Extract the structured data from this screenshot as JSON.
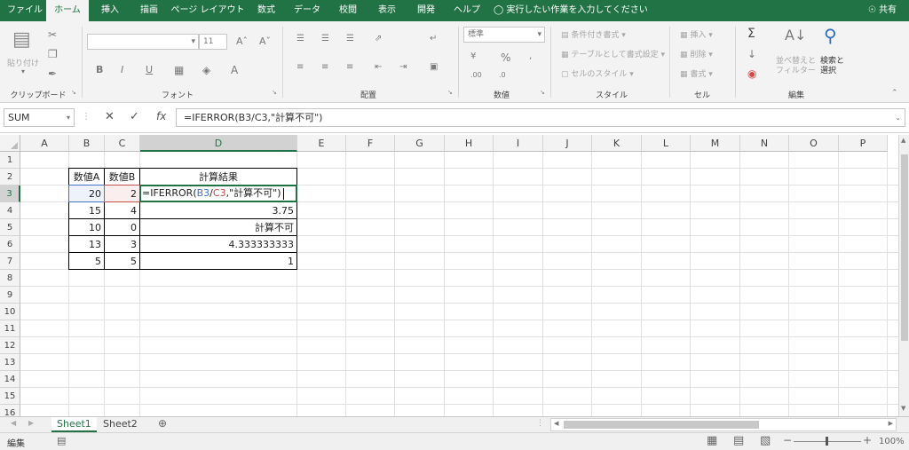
{
  "tabs": [
    {
      "label": "ファイル",
      "active": false
    },
    {
      "label": "ホーム",
      "active": true
    },
    {
      "label": "挿入",
      "active": false
    },
    {
      "label": "描画",
      "active": false
    },
    {
      "label": "ページ レイアウト",
      "active": false
    },
    {
      "label": "数式",
      "active": false
    },
    {
      "label": "データ",
      "active": false
    },
    {
      "label": "校閲",
      "active": false
    },
    {
      "label": "表示",
      "active": false
    },
    {
      "label": "開発",
      "active": false
    },
    {
      "label": "ヘルプ",
      "active": false
    }
  ],
  "tell_me": "実行したい作業を入力してください",
  "share": "共有",
  "ribbon": {
    "paste": "貼り付け",
    "font_size": "11",
    "number_format": "標準",
    "conditional": "条件付き書式",
    "table_format": "テーブルとして書式設定",
    "cell_style": "セルのスタイル",
    "insert": "挿入",
    "delete": "削除",
    "format": "書式",
    "sort_filter": "並べ替えとフィルター",
    "find_select": "検索と選択",
    "groups": {
      "clipboard": "クリップボード",
      "font": "フォント",
      "alignment": "配置",
      "number": "数値",
      "style": "スタイル",
      "cells": "セル",
      "editing": "編集"
    }
  },
  "namebox": "SUM",
  "formula": "=IFERROR(B3/C3,\"計算不可\")",
  "columns": [
    "A",
    "B",
    "C",
    "D",
    "E",
    "F",
    "G",
    "H",
    "I",
    "J",
    "K",
    "L",
    "M",
    "N",
    "O",
    "P"
  ],
  "rows": [
    "1",
    "2",
    "3",
    "4",
    "5",
    "6",
    "7",
    "8",
    "9",
    "10",
    "11",
    "12",
    "13",
    "14",
    "15",
    "16"
  ],
  "table": {
    "headers": [
      "数値A",
      "数値B",
      "計算結果"
    ],
    "rows": [
      [
        "20",
        "2",
        ""
      ],
      [
        "15",
        "4",
        "3.75"
      ],
      [
        "10",
        "0",
        "計算不可"
      ],
      [
        "13",
        "3",
        "4.333333333"
      ],
      [
        "5",
        "5",
        "1"
      ]
    ]
  },
  "edit_formula": {
    "prefix": "=IFERROR(",
    "ref1": "B3",
    "slash": "/",
    "ref2": "C3",
    "suffix": ",\"計算不可\")"
  },
  "colors": {
    "ref1": "#4472c4",
    "ref2": "#c0504d",
    "accent": "#217346"
  },
  "sheets": [
    {
      "label": "Sheet1",
      "active": true
    },
    {
      "label": "Sheet2",
      "active": false
    }
  ],
  "status": {
    "mode": "編集",
    "zoom": "100%"
  }
}
